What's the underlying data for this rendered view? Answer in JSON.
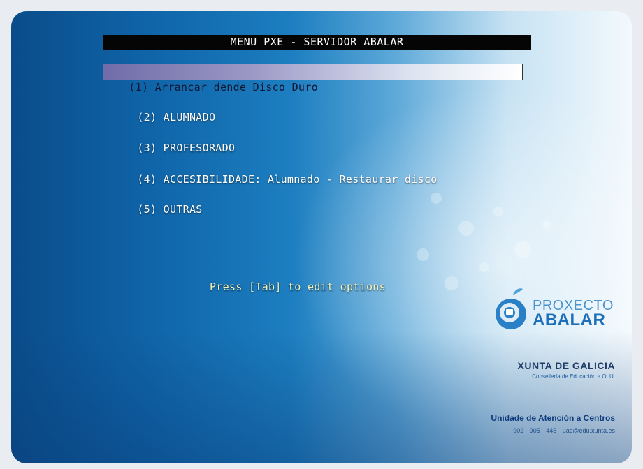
{
  "menu": {
    "title": "MENU PXE - SERVIDOR ABALAR",
    "items": [
      {
        "label": "(1) Arrancar dende Disco Duro"
      },
      {
        "label": "(2) ALUMNADO"
      },
      {
        "label": "(3) PROFESORADO"
      },
      {
        "label": "(4) ACCESIBILIDADE: Alumnado - Restaurar disco"
      },
      {
        "label": "(5) OUTRAS"
      }
    ],
    "hint": "Press [Tab] to edit options"
  },
  "branding": {
    "logo_line1": "PROXECTO",
    "logo_line2": "ABALAR",
    "org_name": "XUNTA DE GALICIA",
    "org_subtitle": "Consellería de Educación e O. U.",
    "support_title": "Unidade de Atención a Centros",
    "support_contact": "902 905 445 uac@edu.xunta.es"
  },
  "colors": {
    "selected_bar_start": "#6f6ca8",
    "hint_text": "#f7f1b8",
    "title_bar": "#050505"
  }
}
